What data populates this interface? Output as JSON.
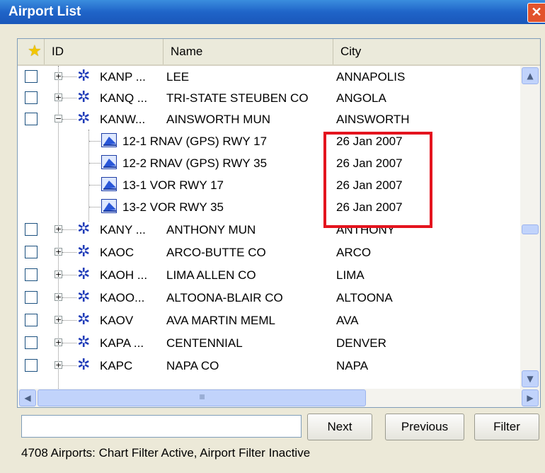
{
  "window": {
    "title": "Airport List",
    "close_glyph": "✕"
  },
  "columns": {
    "id": "ID",
    "name": "Name",
    "city": "City"
  },
  "airports": [
    {
      "id": "KANP ...",
      "name": "LEE",
      "city": "ANNAPOLIS",
      "expander": "+"
    },
    {
      "id": "KANQ ...",
      "name": "TRI-STATE STEUBEN CO",
      "city": "ANGOLA",
      "expander": "+"
    },
    {
      "id": "KANW...",
      "name": "AINSWORTH MUN",
      "city": "AINSWORTH",
      "expander": "−"
    }
  ],
  "charts": [
    {
      "name": "12-1 RNAV (GPS) RWY 17",
      "date": "26 Jan 2007"
    },
    {
      "name": "12-2 RNAV (GPS) RWY 35",
      "date": "26 Jan 2007"
    },
    {
      "name": "13-1 VOR RWY 17",
      "date": "26 Jan 2007"
    },
    {
      "name": "13-2 VOR RWY 35",
      "date": "26 Jan 2007"
    }
  ],
  "airports2": [
    {
      "id": "KANY ...",
      "name": "ANTHONY MUN",
      "city": "ANTHONY",
      "expander": "+"
    },
    {
      "id": "KAOC",
      "name": "ARCO-BUTTE CO",
      "city": "ARCO",
      "expander": "+"
    },
    {
      "id": "KAOH ...",
      "name": "LIMA ALLEN CO",
      "city": "LIMA",
      "expander": "+"
    },
    {
      "id": "KAOO...",
      "name": "ALTOONA-BLAIR CO",
      "city": "ALTOONA",
      "expander": "+"
    },
    {
      "id": "KAOV",
      "name": "AVA MARTIN MEML",
      "city": "AVA",
      "expander": "+"
    },
    {
      "id": "KAPA ...",
      "name": "CENTENNIAL",
      "city": "DENVER",
      "expander": "+"
    },
    {
      "id": "KAPC",
      "name": "NAPA CO",
      "city": "NAPA",
      "expander": "+"
    }
  ],
  "buttons": {
    "next": "Next",
    "previous": "Previous",
    "filter": "Filter"
  },
  "search": {
    "value": ""
  },
  "status": "4708 Airports: Chart Filter Active, Airport Filter Inactive",
  "scroll": {
    "up": "▲",
    "down": "▼",
    "left": "◀",
    "right": "▶",
    "grip": "IIII"
  },
  "icons": {
    "favorite": "star-icon",
    "airport": "gear-icon",
    "chart": "approach-chart-icon"
  },
  "colors": {
    "titlebar": "#1f64c8",
    "highlight": "#e4141e",
    "airport_icon": "#1f3bb8"
  }
}
